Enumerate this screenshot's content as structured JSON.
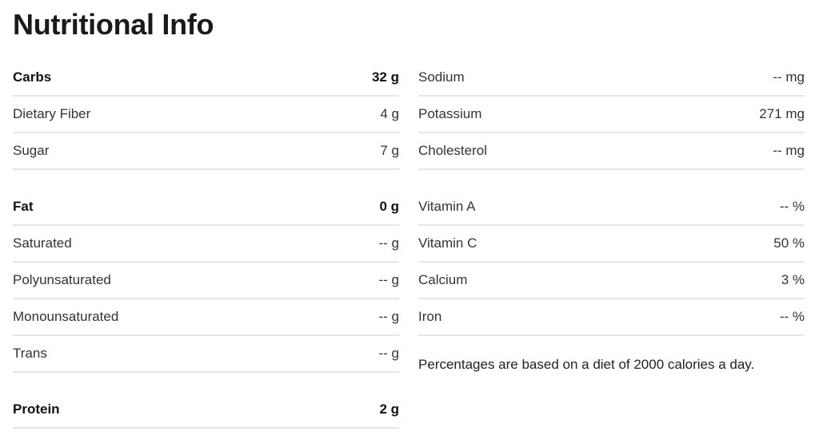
{
  "title": "Nutritional Info",
  "left_column": {
    "groups": [
      {
        "rows": [
          {
            "label": "Carbs",
            "value": "32 g",
            "major": true
          },
          {
            "label": "Dietary Fiber",
            "value": "4 g",
            "major": false
          },
          {
            "label": "Sugar",
            "value": "7 g",
            "major": false
          }
        ]
      },
      {
        "rows": [
          {
            "label": "Fat",
            "value": "0 g",
            "major": true
          },
          {
            "label": "Saturated",
            "value": "-- g",
            "major": false
          },
          {
            "label": "Polyunsaturated",
            "value": "-- g",
            "major": false
          },
          {
            "label": "Monounsaturated",
            "value": "-- g",
            "major": false
          },
          {
            "label": "Trans",
            "value": "-- g",
            "major": false
          }
        ]
      },
      {
        "rows": [
          {
            "label": "Protein",
            "value": "2 g",
            "major": true
          }
        ]
      }
    ]
  },
  "right_column": {
    "groups": [
      {
        "rows": [
          {
            "label": "Sodium",
            "value": "-- mg"
          },
          {
            "label": "Potassium",
            "value": "271 mg"
          },
          {
            "label": "Cholesterol",
            "value": "-- mg"
          }
        ]
      },
      {
        "rows": [
          {
            "label": "Vitamin A",
            "value": "-- %"
          },
          {
            "label": "Vitamin C",
            "value": "50 %"
          },
          {
            "label": "Calcium",
            "value": "3 %"
          },
          {
            "label": "Iron",
            "value": "-- %"
          }
        ]
      }
    ],
    "note": "Percentages are based on a diet of 2000 calories a day."
  }
}
